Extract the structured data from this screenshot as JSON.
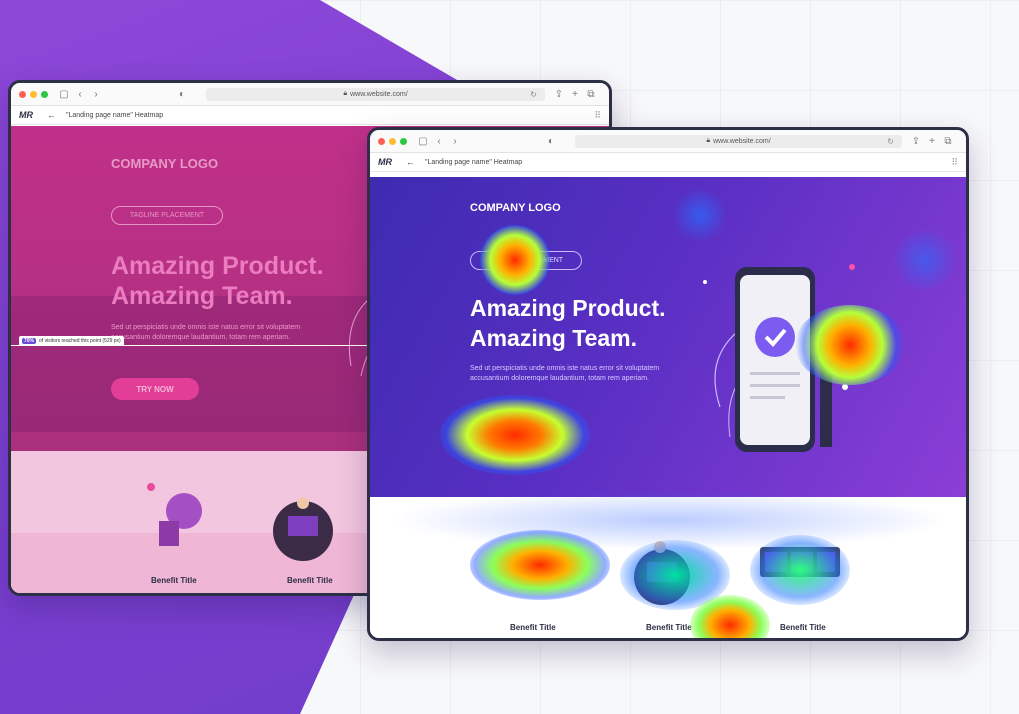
{
  "browser": {
    "url": "www.website.com/",
    "tab_title": "\"Landing page name\" Heatmap",
    "app_logo": "MR",
    "back_arrow": "←"
  },
  "page": {
    "company_logo": "COMPANY LOGO",
    "tagline": "TAGLINE PLACEMENT",
    "headline_line1": "Amazing Product.",
    "headline_line2": "Amazing Team.",
    "body": "Sed ut perspiciatis unde omnis iste natus error sit voluptatem accusantium doloremque laudantium, totam rem aperiam.",
    "cta": "TRY NOW",
    "benefits": [
      "Benefit Title",
      "Benefit Title",
      "Benefit Title"
    ]
  },
  "scroll_marker": {
    "percent": "70%",
    "text": "of visitors reached this point (529 px)"
  },
  "colors": {
    "brand_purple": "#7a3fd1",
    "back_hero_pink": "#c1308a",
    "heat_hot": "#ff2a00",
    "heat_warm": "#ffe600",
    "heat_cool": "#2f5bff"
  },
  "icons": [
    "traffic-lights-icon",
    "sidebar-icon",
    "chevron-left-icon",
    "chevron-right-icon",
    "shield-icon",
    "lock-icon",
    "reload-icon",
    "share-icon",
    "plus-icon",
    "tabs-icon",
    "grid-icon",
    "back-arrow-icon",
    "check-icon"
  ]
}
